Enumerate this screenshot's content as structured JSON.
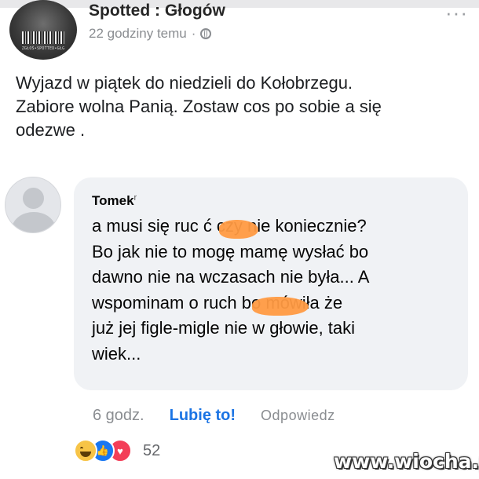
{
  "post": {
    "page_name": "Spotted : Głogów",
    "time": "22 godziny temu",
    "separator": "·",
    "avatar_caption": "ZGŁOŚ•SPOTTED•GŁG",
    "more_icon": "more-options-icon",
    "text_lines": [
      "Wyjazd w piątek do niedzieli do Kołobrzegu.",
      "Zabiore wolna Panią.  Zostaw cos po sobie a się",
      "odezwe ."
    ]
  },
  "comment": {
    "author": "Tomek",
    "author_suffix": "r",
    "lines": [
      "a musi się ruc        ć czy nie koniecznie?",
      "Bo jak nie to mogę mamę wysłać bo",
      "dawno nie na wczasach nie była... A",
      "wspominam o ruch          bo mówiła że",
      "już jej figle-migle nie w głowie, taki",
      "wiek..."
    ],
    "censor_color": "#ff9a42",
    "time": "6 godz.",
    "like_label": "Lubię to!",
    "reply_label": "Odpowiedz",
    "reaction_count": "52",
    "reaction_icons": [
      "haha-reaction-icon",
      "like-reaction-icon",
      "love-reaction-icon"
    ]
  },
  "watermark": "www.wiocha.pl",
  "colors": {
    "accent": "#1b74e4",
    "bubble": "#f0f2f5",
    "muted": "#8a8d91"
  }
}
